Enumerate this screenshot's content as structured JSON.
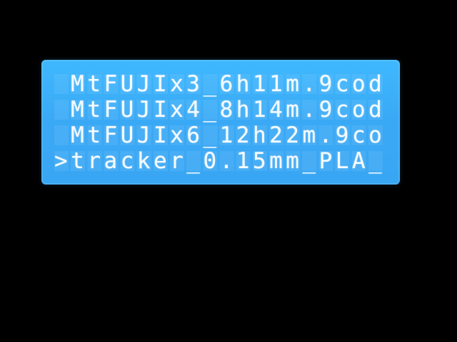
{
  "display": {
    "rows": [
      {
        "text": " MtFUJIx3_6h11m.9cod"
      },
      {
        "text": " MtFUJIx4_8h14m.9cod"
      },
      {
        "text": " MtFUJIx6_12h22m.9co"
      },
      {
        "text": ">tracker_0.15mm_PLA_"
      }
    ]
  }
}
